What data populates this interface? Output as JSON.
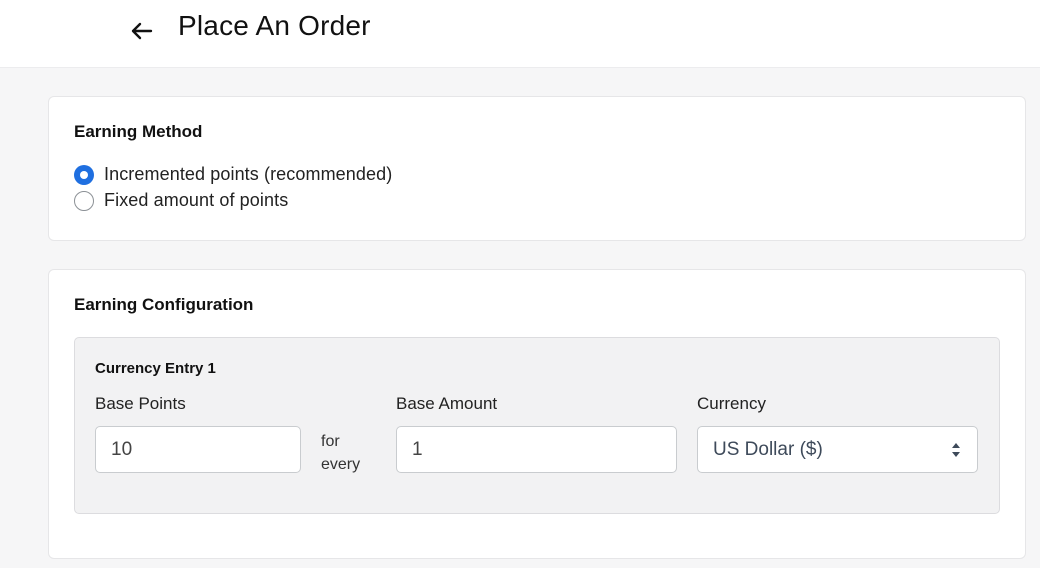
{
  "header": {
    "title": "Place An Order",
    "back_icon": "arrow-left-icon"
  },
  "earning_method": {
    "title": "Earning Method",
    "options": [
      {
        "label": "Incremented points (recommended)",
        "selected": true
      },
      {
        "label": "Fixed amount of points",
        "selected": false
      }
    ]
  },
  "earning_configuration": {
    "title": "Earning Configuration",
    "entry": {
      "title": "Currency Entry 1",
      "base_points_label": "Base Points",
      "base_points_value": "10",
      "for_every_text": "for every",
      "base_amount_label": "Base Amount",
      "base_amount_value": "1",
      "currency_label": "Currency",
      "currency_value": "US Dollar ($)",
      "currency_icon": "select-arrows-icon"
    }
  },
  "colors": {
    "accent": "#1f6fe0",
    "background": "#f6f6f7",
    "card": "#ffffff",
    "entry_box": "#f2f2f3"
  }
}
